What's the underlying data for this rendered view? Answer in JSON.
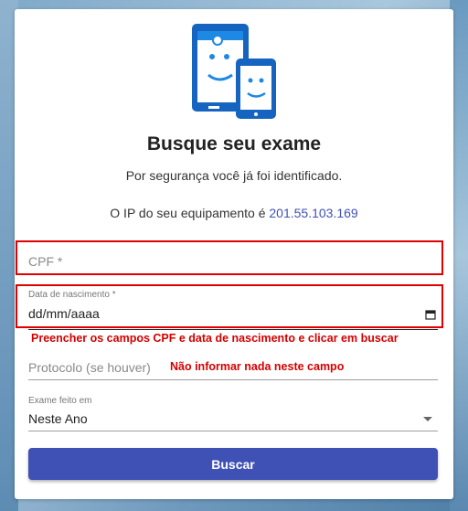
{
  "header": {
    "title": "Busque seu exame",
    "subtitle": "Por segurança você já foi identificado.",
    "ip_prefix": "O IP do seu equipamento é ",
    "ip_value": "201.55.103.169"
  },
  "form": {
    "cpf": {
      "placeholder": "CPF *"
    },
    "birth_date": {
      "label": "Data de nascimento *",
      "value": "dd/mm/aaaa"
    },
    "protocolo": {
      "placeholder": "Protocolo (se houver)"
    },
    "exame_feito_em": {
      "label": "Exame feito em",
      "selected": "Neste Ano"
    },
    "submit_label": "Buscar"
  },
  "annotations": {
    "fill_instruction": "Preencher os campos  CPF e data de nascimento e clicar em buscar",
    "protocolo_instruction": "Não informar nada neste campo"
  },
  "colors": {
    "accent": "#3f51b5",
    "annotation_red": "#e00000",
    "logo_blue": "#1565c0"
  }
}
